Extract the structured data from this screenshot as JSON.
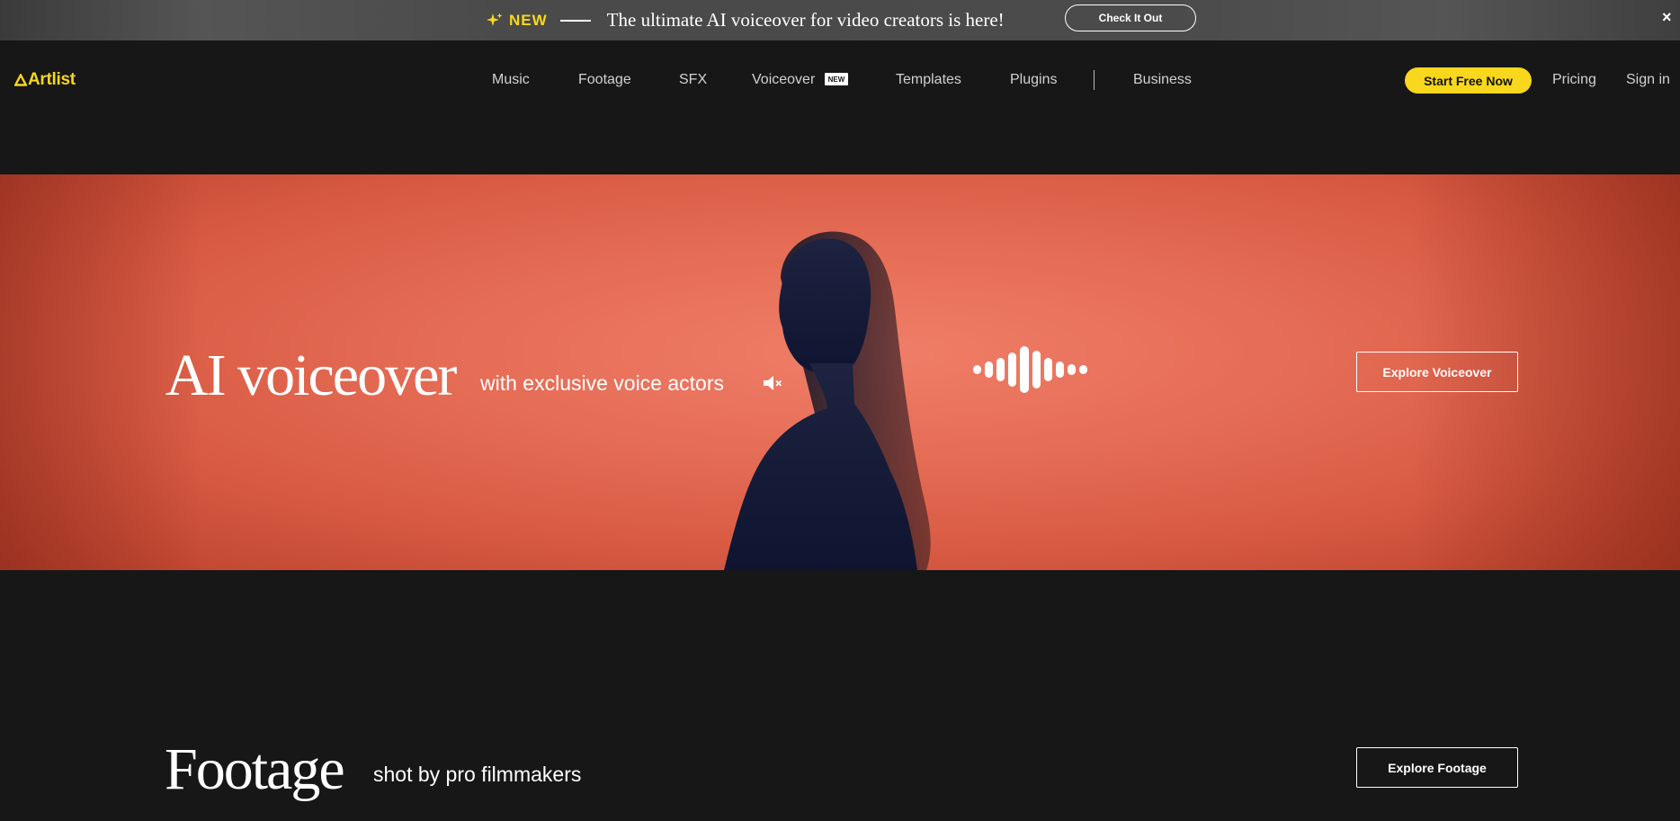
{
  "banner": {
    "new_label": "NEW",
    "message": "The ultimate AI voiceover for video creators is here!",
    "cta": "Check It Out",
    "close": "×"
  },
  "nav": {
    "logo": "Artlist",
    "items": [
      "Music",
      "Footage",
      "SFX",
      "Voiceover",
      "Templates",
      "Plugins",
      "Business"
    ],
    "voiceover_badge": "NEW",
    "start": "Start Free Now",
    "pricing": "Pricing",
    "signin": "Sign in"
  },
  "hero": {
    "title": "AI voiceover",
    "subtitle": "with exclusive voice actors",
    "cta": "Explore Voiceover"
  },
  "footage": {
    "title": "Footage",
    "subtitle": "shot by pro filmmakers",
    "cta": "Explore Footage"
  },
  "colors": {
    "brand_yellow": "#f9d71c",
    "background": "#171717",
    "hero_coral": "#e56c55"
  }
}
